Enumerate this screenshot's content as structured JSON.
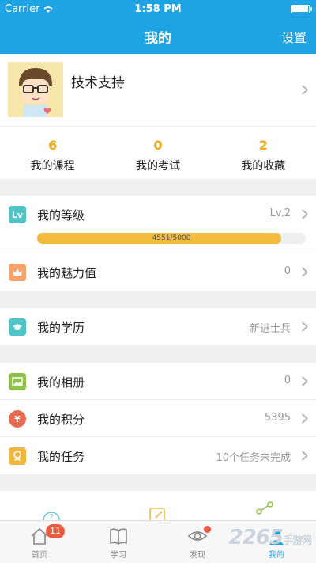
{
  "status_bar": {
    "carrier": "Carrier",
    "time": "1:58 PM"
  },
  "nav": {
    "title": "我的",
    "settings": "设置"
  },
  "profile": {
    "name": "技术支持"
  },
  "stats": [
    {
      "value": "6",
      "label": "我的课程"
    },
    {
      "value": "0",
      "label": "我的考试"
    },
    {
      "value": "2",
      "label": "我的收藏"
    }
  ],
  "level": {
    "label": "我的等级",
    "value": "Lv.2",
    "progress_text": "4551/5000",
    "progress": 0.9102
  },
  "charm": {
    "label": "我的魅力值",
    "value": "0"
  },
  "education": {
    "label": "我的学历",
    "value": "新进士兵"
  },
  "album": {
    "label": "我的相册",
    "value": "0"
  },
  "points": {
    "label": "我的积分",
    "value": "5395"
  },
  "tasks": {
    "label": "我的任务",
    "value": "10个任务未完成"
  },
  "tabs": [
    {
      "label": "首页",
      "badge": "11"
    },
    {
      "label": "学习"
    },
    {
      "label": "发现"
    },
    {
      "label": "我的"
    }
  ],
  "colors": {
    "primary": "#1ea3e5",
    "accent": "#f0a817",
    "badge": "#ef5a42"
  }
}
